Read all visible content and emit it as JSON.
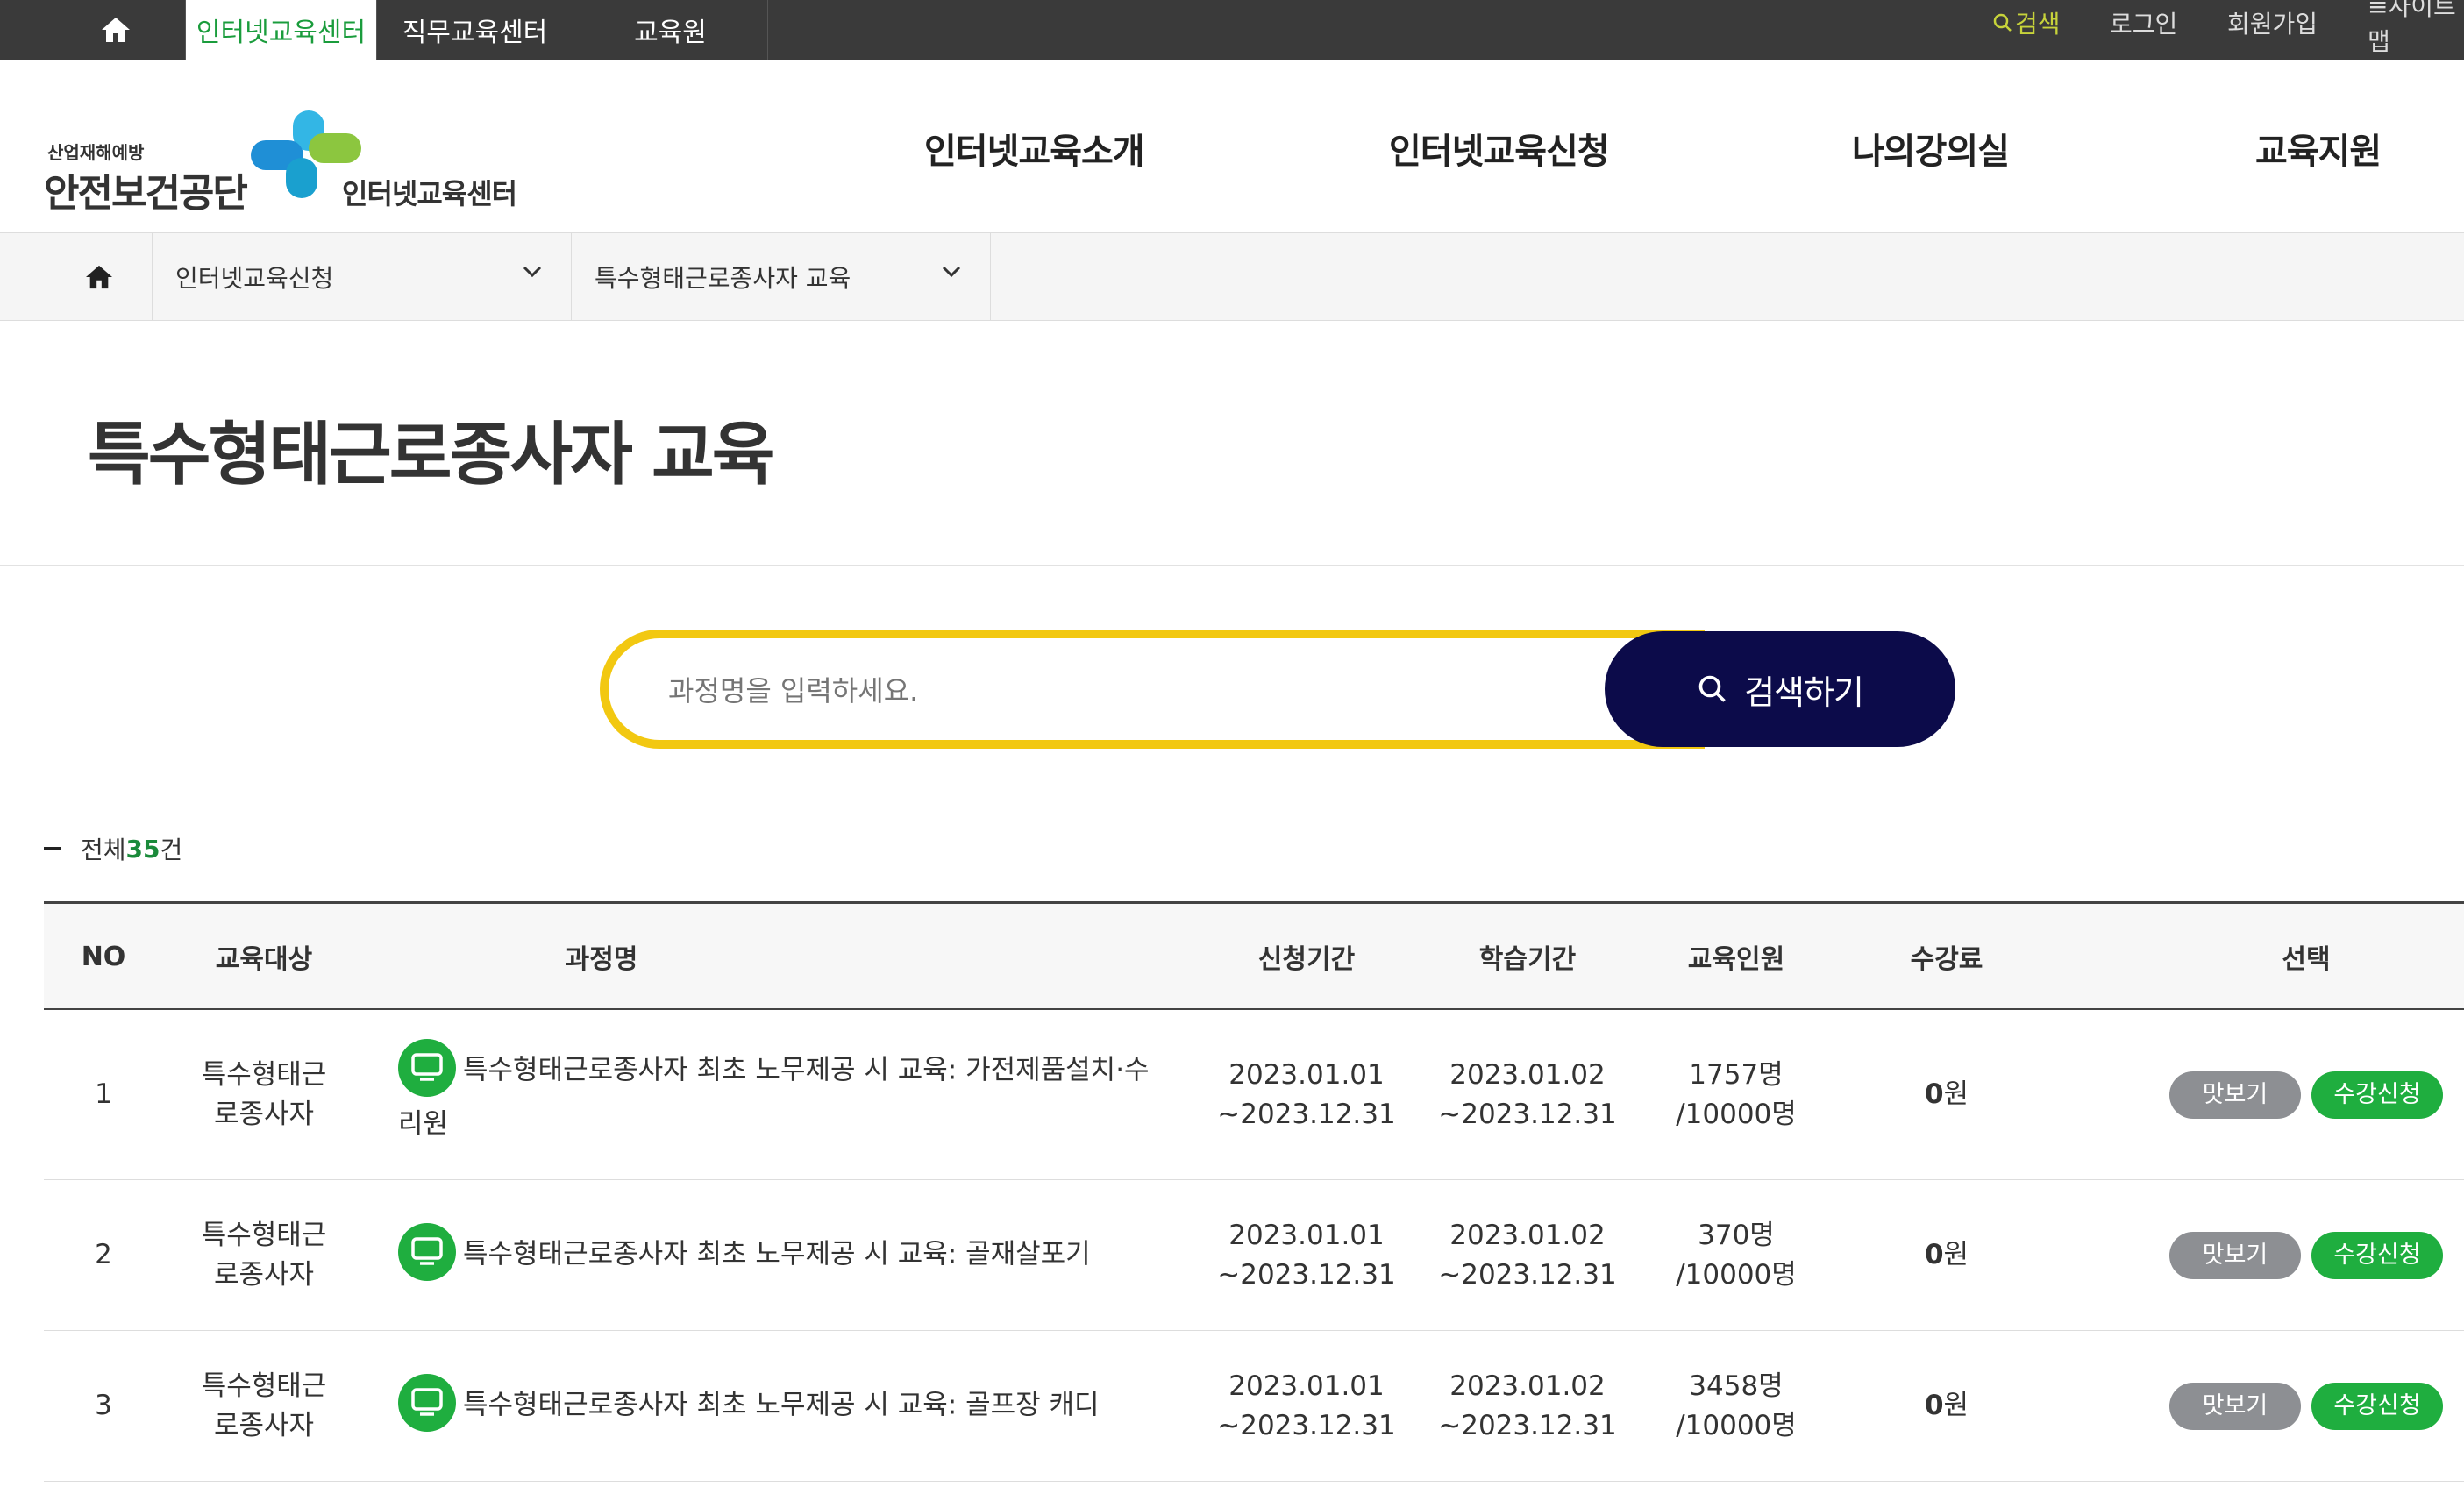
{
  "topbar": {
    "tabs": [
      {
        "label": "인터넷교육센터",
        "active": true
      },
      {
        "label": "직무교육센터",
        "active": false
      },
      {
        "label": "교육원",
        "active": false
      }
    ],
    "utils": {
      "search": "검색",
      "login": "로그인",
      "signup": "회원가입",
      "sitemap": "≡사이트맵"
    }
  },
  "header": {
    "logo_small": "산업재해예방",
    "logo_big": "안전보건공단",
    "logo_sub": "인터넷교육센터",
    "gnb": [
      "인터넷교육소개",
      "인터넷교육신청",
      "나의강의실",
      "교육지원"
    ]
  },
  "location": {
    "depth1": "인터넷교육신청",
    "depth2": "특수형태근로종사자 교육"
  },
  "page": {
    "title": "특수형태근로종사자 교육"
  },
  "search": {
    "placeholder": "과정명을 입력하세요.",
    "button": "검색하기"
  },
  "count": {
    "prefix": "전체 ",
    "value": "35",
    "suffix": "건"
  },
  "table": {
    "headers": [
      "NO",
      "교육대상",
      "과정명",
      "신청기간",
      "학습기간",
      "교육인원",
      "수강료",
      "선택"
    ],
    "rows": [
      {
        "no": "1",
        "target_line1": "특수형태근",
        "target_line2": "로종사자",
        "title": "특수형태근로종사자 최초 노무제공 시 교육: 가전제품설치·수리원",
        "apply_start": "2023.01.01",
        "apply_end": "~2023.12.31",
        "study_start": "2023.01.02",
        "study_end": "~2023.12.31",
        "enrolled": "1757명",
        "capacity": "/10000명",
        "fee_num": "0",
        "fee_unit": "원",
        "preview": "맛보기",
        "apply": "수강신청"
      },
      {
        "no": "2",
        "target_line1": "특수형태근",
        "target_line2": "로종사자",
        "title": "특수형태근로종사자 최초 노무제공 시 교육: 골재살포기",
        "apply_start": "2023.01.01",
        "apply_end": "~2023.12.31",
        "study_start": "2023.01.02",
        "study_end": "~2023.12.31",
        "enrolled": "370명",
        "capacity": "/10000명",
        "fee_num": "0",
        "fee_unit": "원",
        "preview": "맛보기",
        "apply": "수강신청"
      },
      {
        "no": "3",
        "target_line1": "특수형태근",
        "target_line2": "로종사자",
        "title": "특수형태근로종사자 최초 노무제공 시 교육: 골프장 캐디",
        "apply_start": "2023.01.01",
        "apply_end": "~2023.12.31",
        "study_start": "2023.01.02",
        "study_end": "~2023.12.31",
        "enrolled": "3458명",
        "capacity": "/10000명",
        "fee_num": "0",
        "fee_unit": "원",
        "preview": "맛보기",
        "apply": "수강신청"
      }
    ]
  },
  "colors": {
    "topbar_bg": "#3a3a3a",
    "active_tab_text": "#1a9c3c",
    "search_util": "#c7d33a",
    "search_border": "#f2c811",
    "search_button": "#0c0b4a",
    "apply_button": "#1fae3f",
    "preview_button": "#8d8f93"
  }
}
